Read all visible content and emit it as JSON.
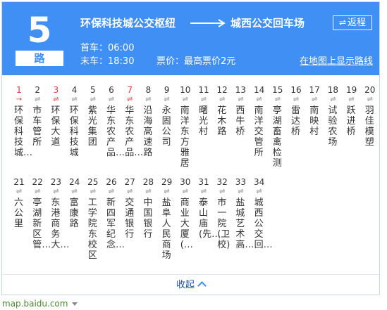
{
  "header": {
    "line_number": "5",
    "line_suffix": "路",
    "from": "环保科技城公交枢纽",
    "to": "城西公交回车场",
    "reverse_label": "返程",
    "reverse_icon": "swap-arrows-icon",
    "first_bus": "首车：06:00",
    "last_bus": "末车：18:30",
    "fare": "票价：最高票价2元",
    "map_link": "在地图上显示路线"
  },
  "stops": [
    {
      "num": "1",
      "name": "环保科技城…",
      "highlight": true
    },
    {
      "num": "2",
      "name": "市车管所",
      "highlight": false
    },
    {
      "num": "3",
      "name": "环保大道",
      "highlight": true
    },
    {
      "num": "4",
      "name": "环保科技城",
      "highlight": false
    },
    {
      "num": "5",
      "name": "紫光集团",
      "highlight": false
    },
    {
      "num": "6",
      "name": "华东农产品…",
      "highlight": false
    },
    {
      "num": "7",
      "name": "华东农产品…",
      "highlight": true
    },
    {
      "num": "8",
      "name": "沿海高速路",
      "highlight": false
    },
    {
      "num": "9",
      "name": "永固公司",
      "highlight": false
    },
    {
      "num": "10",
      "name": "南洋东方雅居",
      "highlight": false
    },
    {
      "num": "11",
      "name": "曙光村",
      "highlight": false
    },
    {
      "num": "12",
      "name": "花木路",
      "highlight": false
    },
    {
      "num": "13",
      "name": "西牛桥",
      "highlight": false
    },
    {
      "num": "14",
      "name": "南洋交管所",
      "highlight": false
    },
    {
      "num": "15",
      "name": "亭湖畜禽检测",
      "highlight": false
    },
    {
      "num": "16",
      "name": "雷达桥",
      "highlight": false
    },
    {
      "num": "17",
      "name": "南映村",
      "highlight": false
    },
    {
      "num": "18",
      "name": "试验农场",
      "highlight": false
    },
    {
      "num": "19",
      "name": "跃进桥",
      "highlight": false
    },
    {
      "num": "20",
      "name": "羽佳模塑",
      "highlight": false
    },
    {
      "num": "21",
      "name": "六公里",
      "highlight": false
    },
    {
      "num": "22",
      "name": "亭湖新区管…",
      "highlight": false
    },
    {
      "num": "23",
      "name": "东港商务大…",
      "highlight": false
    },
    {
      "num": "24",
      "name": "富康路",
      "highlight": false
    },
    {
      "num": "25",
      "name": "工学院东校区",
      "highlight": false
    },
    {
      "num": "26",
      "name": "新四军纪念…",
      "highlight": false
    },
    {
      "num": "27",
      "name": "交通银行",
      "highlight": false
    },
    {
      "num": "28",
      "name": "中国银行",
      "highlight": false
    },
    {
      "num": "29",
      "name": "盐阜人民商场",
      "highlight": false
    },
    {
      "num": "30",
      "name": "商业大厦(…",
      "highlight": false
    },
    {
      "num": "31",
      "name": "泰山庙(先…",
      "highlight": false
    },
    {
      "num": "32",
      "name": "市一院(卫校)",
      "highlight": false
    },
    {
      "num": "33",
      "name": "盐城艺术高…",
      "highlight": false
    },
    {
      "num": "34",
      "name": "城西公交回…",
      "highlight": false
    }
  ],
  "first_stop_direction": "→",
  "other_stop_direction": "⇌",
  "footer": {
    "collapse_label": "收起",
    "collapse_icon": "chevron-up-icon"
  },
  "source": "map.baidu.com",
  "colors": {
    "header_bg": "#3f8ff5",
    "highlight": "#e03b3b",
    "link": "#1e4fa0",
    "source": "#4b8a2f"
  }
}
